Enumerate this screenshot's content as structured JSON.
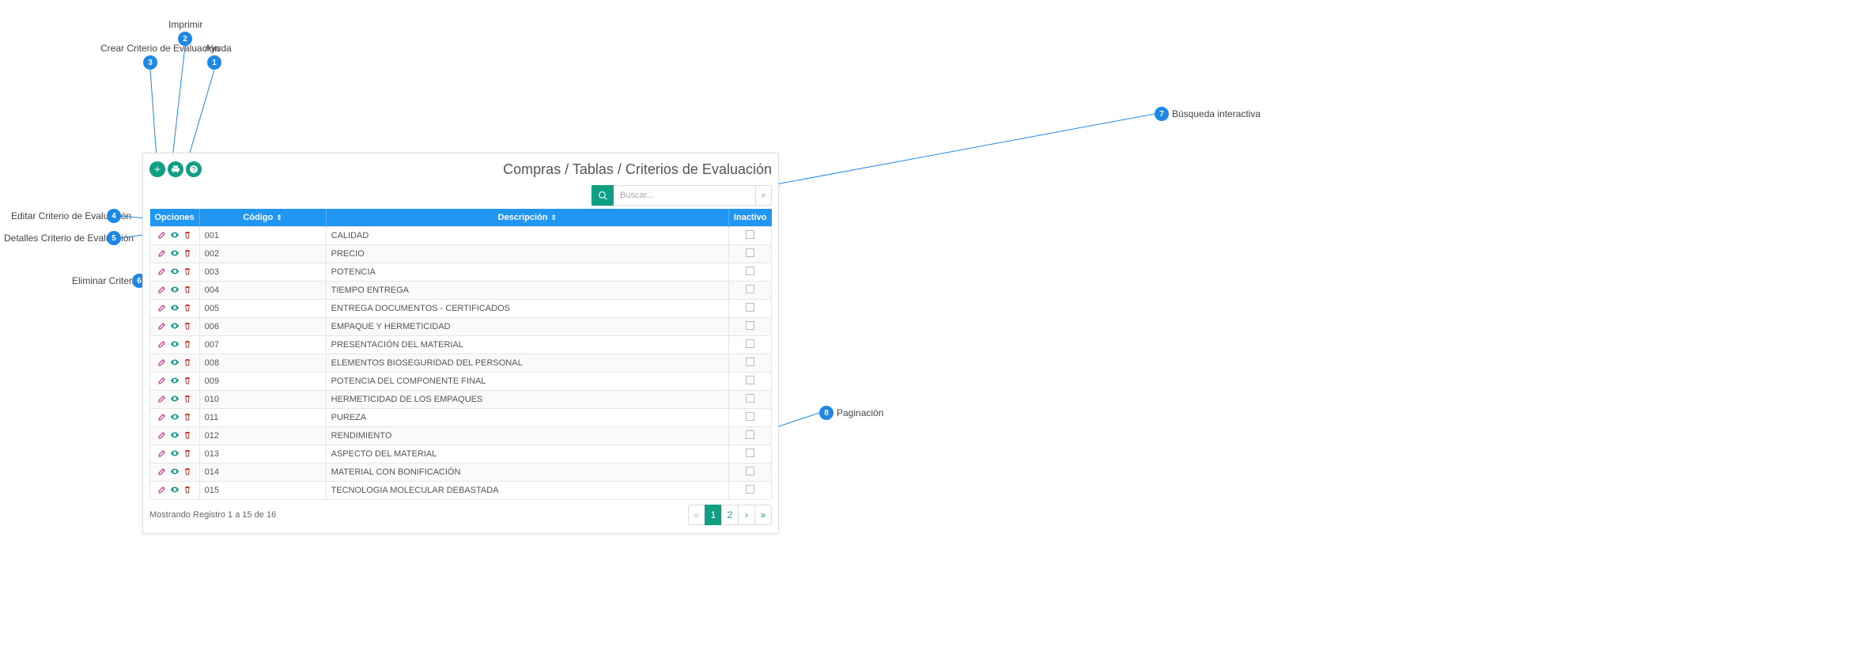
{
  "callouts": {
    "c1": {
      "num": "1",
      "label": "Ayuda"
    },
    "c2": {
      "num": "2",
      "label": "Imprimir"
    },
    "c3": {
      "num": "3",
      "label": "Crear Criterio de Evaluación"
    },
    "c4": {
      "num": "4",
      "label": "Editar Criterio de Evaluación"
    },
    "c5": {
      "num": "5",
      "label": "Detalles Criterio de Evaluación"
    },
    "c6": {
      "num": "6",
      "label": "Eliminar Criterio"
    },
    "c7": {
      "num": "7",
      "label": "Búsqueda interactiva"
    },
    "c8": {
      "num": "8",
      "label": "Paginación"
    }
  },
  "breadcrumb": "Compras / Tablas / Criterios de Evaluación",
  "search": {
    "placeholder": "Buscar..."
  },
  "table": {
    "headers": {
      "opciones": "Opciones",
      "codigo": "Código",
      "descripcion": "Descripción",
      "inactivo": "Inactivo"
    },
    "rows": [
      {
        "codigo": "001",
        "descripcion": "CALIDAD",
        "inactivo": false
      },
      {
        "codigo": "002",
        "descripcion": "PRECIO",
        "inactivo": false
      },
      {
        "codigo": "003",
        "descripcion": "POTENCIA",
        "inactivo": false
      },
      {
        "codigo": "004",
        "descripcion": "TIEMPO ENTREGA",
        "inactivo": false
      },
      {
        "codigo": "005",
        "descripcion": "ENTREGA DOCUMENTOS - CERTIFICADOS",
        "inactivo": false
      },
      {
        "codigo": "006",
        "descripcion": "EMPAQUE Y HERMETICIDAD",
        "inactivo": false
      },
      {
        "codigo": "007",
        "descripcion": "PRESENTACIÓN DEL MATERIAL",
        "inactivo": false
      },
      {
        "codigo": "008",
        "descripcion": "ELEMENTOS BIOSEGURIDAD DEL PERSONAL",
        "inactivo": false
      },
      {
        "codigo": "009",
        "descripcion": "POTENCIA DEL COMPONENTE FINAL",
        "inactivo": false
      },
      {
        "codigo": "010",
        "descripcion": "HERMETICIDAD DE LOS EMPAQUES",
        "inactivo": false
      },
      {
        "codigo": "011",
        "descripcion": "PUREZA",
        "inactivo": false
      },
      {
        "codigo": "012",
        "descripcion": "RENDIMIENTO",
        "inactivo": false
      },
      {
        "codigo": "013",
        "descripcion": "ASPECTO DEL MATERIAL",
        "inactivo": false
      },
      {
        "codigo": "014",
        "descripcion": "MATERIAL CON BONIFICACIÓN",
        "inactivo": false
      },
      {
        "codigo": "015",
        "descripcion": "TECNOLOGIA MOLECULAR DEBASTADA",
        "inactivo": false
      }
    ]
  },
  "footer": {
    "summary": "Mostrando Registro 1 a 15 de 16",
    "pages": [
      "«",
      "1",
      "2",
      "›",
      "»"
    ],
    "active_page": "1"
  },
  "sort_glyph": "⇕"
}
